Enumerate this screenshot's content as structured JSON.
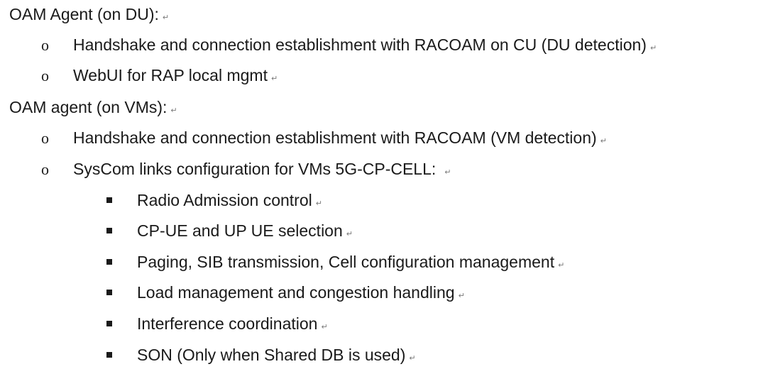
{
  "doc": {
    "h1": "OAM Agent (on DU):",
    "du_items": [
      "Handshake and connection establishment with RACOAM on CU (DU detection)",
      "WebUI for RAP local mgmt"
    ],
    "h2": "OAM agent (on VMs):",
    "vm_items": [
      "Handshake and connection establishment with RACOAM (VM detection)",
      "SysCom links configuration for VMs 5G-CP-CELL:"
    ],
    "cell_items": [
      "Radio Admission control",
      "CP-UE and UP UE selection",
      "Paging, SIB transmission, Cell configuration management",
      "Load management and congestion handling",
      "Interference coordination",
      "SON (Only when Shared DB is used)"
    ],
    "bullet_circle": "o",
    "para_mark": "↵"
  }
}
